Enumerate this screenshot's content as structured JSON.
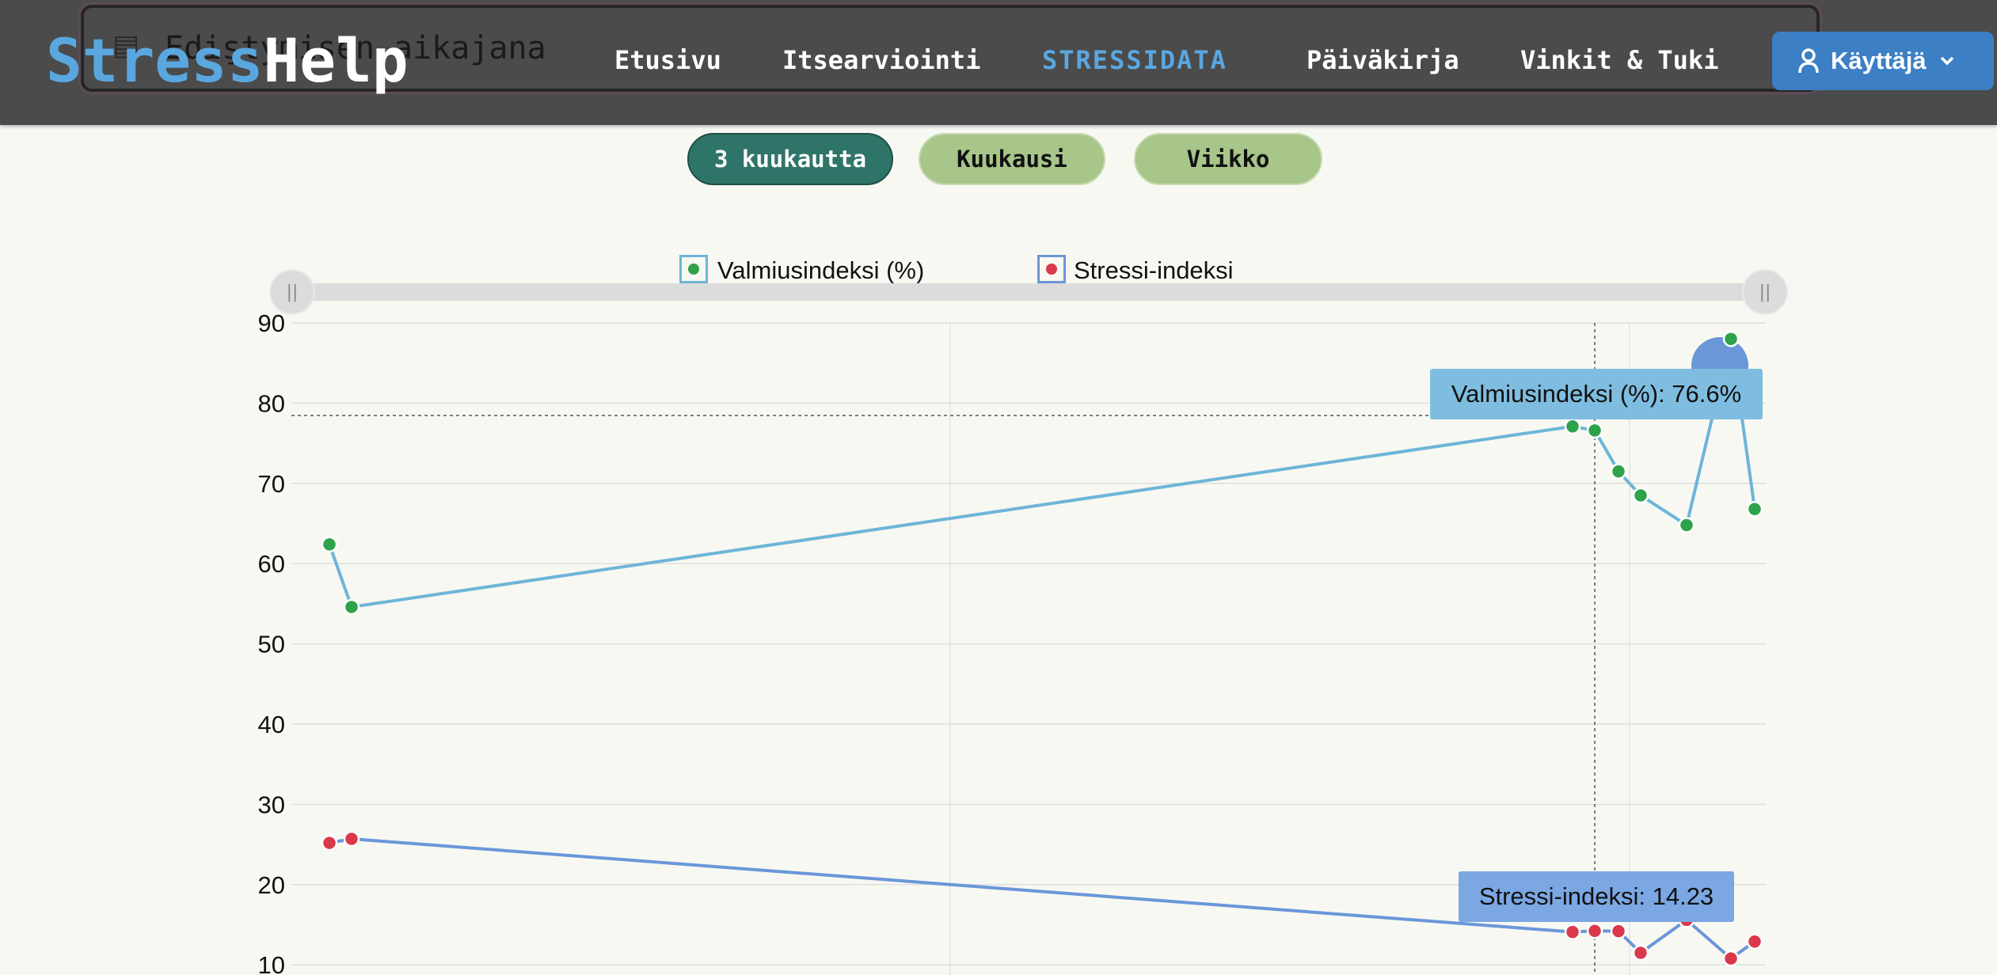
{
  "header": {
    "logo_part1": "Stress",
    "logo_part2": "Help",
    "background_title": "Ediştymisen aikajana",
    "nav": [
      {
        "label": "Etusivu"
      },
      {
        "label": "Itsearviointi"
      },
      {
        "label": "STRESSIDATA",
        "active": true
      },
      {
        "label": "Päiväkirja"
      },
      {
        "label": "Vinkit & Tuki"
      }
    ],
    "user_menu": {
      "label": "Käyttäjä",
      "icon": "user-icon",
      "caret": "chevron-down-icon"
    }
  },
  "range_buttons": [
    {
      "label": "3 kuukautta",
      "selected": true
    },
    {
      "label": "Kuukausi",
      "selected": false
    },
    {
      "label": "Viikko",
      "selected": false
    }
  ],
  "colors": {
    "header_bg": "#4b4b4b",
    "accent_blue": "#5aa7e0",
    "selected_pill": "#2f7468",
    "pill": "#a8c58a",
    "ready_line": "#6db5d8",
    "ready_point": "#2fa24c",
    "stress_line": "#6a97d8",
    "stress_point": "#d9394a"
  },
  "chart_data": {
    "type": "line",
    "legend": [
      "Valmiusindeksi (%)",
      "Stressi-indeksi"
    ],
    "y_ticks": [
      90,
      80,
      70,
      60,
      50,
      40,
      30,
      20,
      10
    ],
    "ylim": [
      10,
      90
    ],
    "grid": true,
    "legend_placement": "top-center",
    "x_points": 12,
    "series": [
      {
        "name": "Valmiusindeksi (%)",
        "values": [
          62.4,
          54.6,
          77.1,
          76.6,
          71.5,
          68.5,
          64.8,
          88.0,
          66.8
        ],
        "x_index": [
          0,
          1,
          6,
          7,
          8,
          9,
          10,
          11,
          12
        ]
      },
      {
        "name": "Stressi-indeksi",
        "values": [
          25.2,
          25.7,
          14.1,
          14.23,
          14.2,
          11.5,
          15.6,
          10.8,
          12.9
        ],
        "x_index": [
          0,
          1,
          6,
          7,
          8,
          9,
          10,
          11,
          12
        ]
      }
    ],
    "tooltips": {
      "ready": "Valmiusindeksi (%): 76.6%",
      "stress": "Stressi-indeksi: 14.23"
    }
  }
}
